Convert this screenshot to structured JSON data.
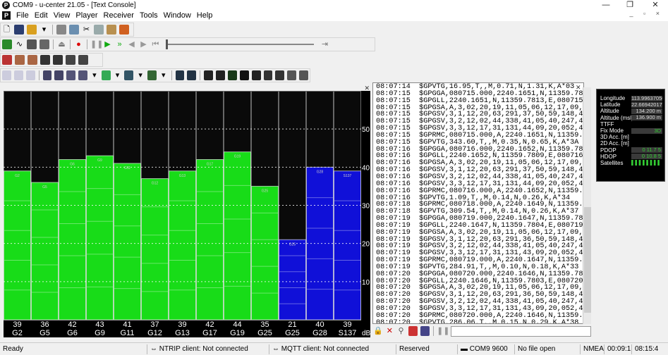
{
  "window": {
    "title": "COM9 - u-center 21.05 - [Text Console]",
    "minimize": "—",
    "restore": "❐",
    "close": "✕"
  },
  "menu": {
    "items": [
      "File",
      "Edit",
      "View",
      "Player",
      "Receiver",
      "Tools",
      "Window",
      "Help"
    ],
    "mdi_controls": "_ ▫ ×"
  },
  "colors": {
    "gps_used": "#18dc18",
    "sbas_used": "#1010d8",
    "unused": "#0a0a0a",
    "title_label": "#cccccc"
  },
  "chart_data": {
    "type": "bar",
    "ylim": [
      0,
      60
    ],
    "yticks": [
      10,
      20,
      30,
      40,
      50
    ],
    "y_unit": "dB",
    "categories": [
      "G2",
      "G5",
      "G6",
      "G9",
      "G11",
      "G12",
      "G13",
      "G17",
      "G19",
      "G25",
      "G25",
      "G28",
      "S137"
    ],
    "values": [
      39,
      36,
      42,
      43,
      41,
      37,
      39,
      42,
      44,
      35,
      21,
      40,
      39
    ],
    "bar_labels": [
      "G2",
      "G5",
      "G6",
      "G9",
      "G11",
      "G12",
      "G13",
      "G17",
      "G19",
      "G25",
      "G25",
      "G28",
      "S137"
    ],
    "bar_colors": [
      "green",
      "green",
      "green",
      "green",
      "green",
      "green",
      "green",
      "green",
      "green",
      "green",
      "blue",
      "blue",
      "blue"
    ],
    "x_labels": [
      "G2",
      "G5",
      "G6",
      "G9",
      "G11",
      "G12",
      "G13",
      "G17",
      "G19",
      "G25",
      "G25",
      "G28",
      "S137"
    ]
  },
  "console": {
    "lines": [
      "08:07:14  $GPVTG,16.95,T,,M,0.71,N,1.31,K,A*03",
      "08:07:15  $GPGGA,080715.000,2240.1651,N,11359.781",
      "08:07:15  $GPGLL,2240.1651,N,11359.7813,E,080715.",
      "08:07:15  $GPGSA,A,3,02,20,19,11,05,06,12,17,09,1",
      "08:07:15  $GPGSV,3,1,12,20,63,291,37,50,59,148,41",
      "08:07:15  $GPGSV,3,2,12,02,44,338,41,05,40,247,41",
      "08:07:15  $GPGSV,3,3,12,17,31,131,44,09,20,052,45",
      "08:07:15  $GPRMC,080715.000,A,2240.1651,N,11359.7",
      "08:07:15  $GPVTG,343.60,T,,M,0.35,N,0.65,K,A*3A",
      "08:07:16  $GPGGA,080716.000,2240.1652,N,11359.780",
      "08:07:16  $GPGLL,2240.1652,N,11359.7809,E,080716.",
      "08:07:16  $GPGSA,A,3,02,20,19,11,05,06,12,17,09,1",
      "08:07:16  $GPGSV,3,1,12,20,63,291,37,50,59,148,40",
      "08:07:16  $GPGSV,3,2,12,02,44,338,41,05,40,247,42",
      "08:07:16  $GPGSV,3,3,12,17,31,131,44,09,20,052,45",
      "08:07:16  $GPRMC,080716.000,A,2240.1652,N,11359.7",
      "08:07:16  $GPVTG,1.09,T,,M,0.14,N,0.26,K,A*34",
      "08:07:18  $GPRMC,080718.000,A,2240.1649,N,11359.7",
      "08:07:18  $GPVTG,309.54,T,,M,0.14,N,0.26,K,A*37",
      "08:07:19  $GPGGA,080719.000,2240.1647,N,11359.780",
      "08:07:19  $GPGLL,2240.1647,N,11359.7804,E,080719.",
      "08:07:19  $GPGSA,A,3,02,20,19,11,05,06,12,17,09,1",
      "08:07:19  $GPGSV,3,1,12,20,63,291,36,50,59,148,42",
      "08:07:19  $GPGSV,3,2,12,02,44,338,41,05,40,247,41",
      "08:07:19  $GPGSV,3,3,12,17,31,131,43,09,20,052,45",
      "08:07:19  $GPRMC,080719.000,A,2240.1647,N,11359.7",
      "08:07:19  $GPVTG,284.91,T,,M,0.10,N,0.18,K,A*33",
      "08:07:20  $GPGGA,080720.000,2240.1646,N,11359.780",
      "08:07:20  $GPGLL,2240.1646,N,11359.7803,E,080720.",
      "08:07:20  $GPGSA,A,3,02,20,19,11,05,06,12,17,09,1",
      "08:07:20  $GPGSV,3,1,12,20,63,291,36,50,59,148,41",
      "08:07:20  $GPGSV,3,2,12,02,44,338,41,05,40,247,40",
      "08:07:20  $GPGSV,3,3,12,17,31,131,43,09,20,052,44",
      "08:07:20  $GPRMC,080720.000,A,2240.1646,N,11359.7",
      "08:07:20  $GPVTG,286.06,T,,M,0.15,N,0.29,K,A*38"
    ]
  },
  "info": {
    "rows": [
      {
        "label": "Longitude",
        "value": "113.99637050 °"
      },
      {
        "label": "Latitude",
        "value": "22.66942017 °"
      },
      {
        "label": "Altitude",
        "value": "134.200 m"
      },
      {
        "label": "Altitude (msl)",
        "value": "136.900 m"
      },
      {
        "label": "TTFF",
        "value": ""
      },
      {
        "label": "Fix Mode",
        "value": "3D"
      },
      {
        "label": "3D Acc. [m]",
        "value": ""
      },
      {
        "label": "2D Acc. [m]",
        "value": ""
      },
      {
        "label": "PDOP",
        "value": "0 11.7 5"
      },
      {
        "label": "HDOP",
        "value": "0 10.8 5"
      },
      {
        "label": "Satellites",
        "value": "▌▌▌▌▌▌▌▌"
      }
    ]
  },
  "status": {
    "ready": "Ready",
    "ntrip": "⇔ NTRIP client: Not connected",
    "mqtt": "⇔ MQTT client: Not connected",
    "reserved": "Reserved",
    "port": "▬ COM9 9600",
    "file": "No file open",
    "protocol": "NMEA",
    "elapsed": "00:09:1",
    "clock": "08:15:4"
  }
}
